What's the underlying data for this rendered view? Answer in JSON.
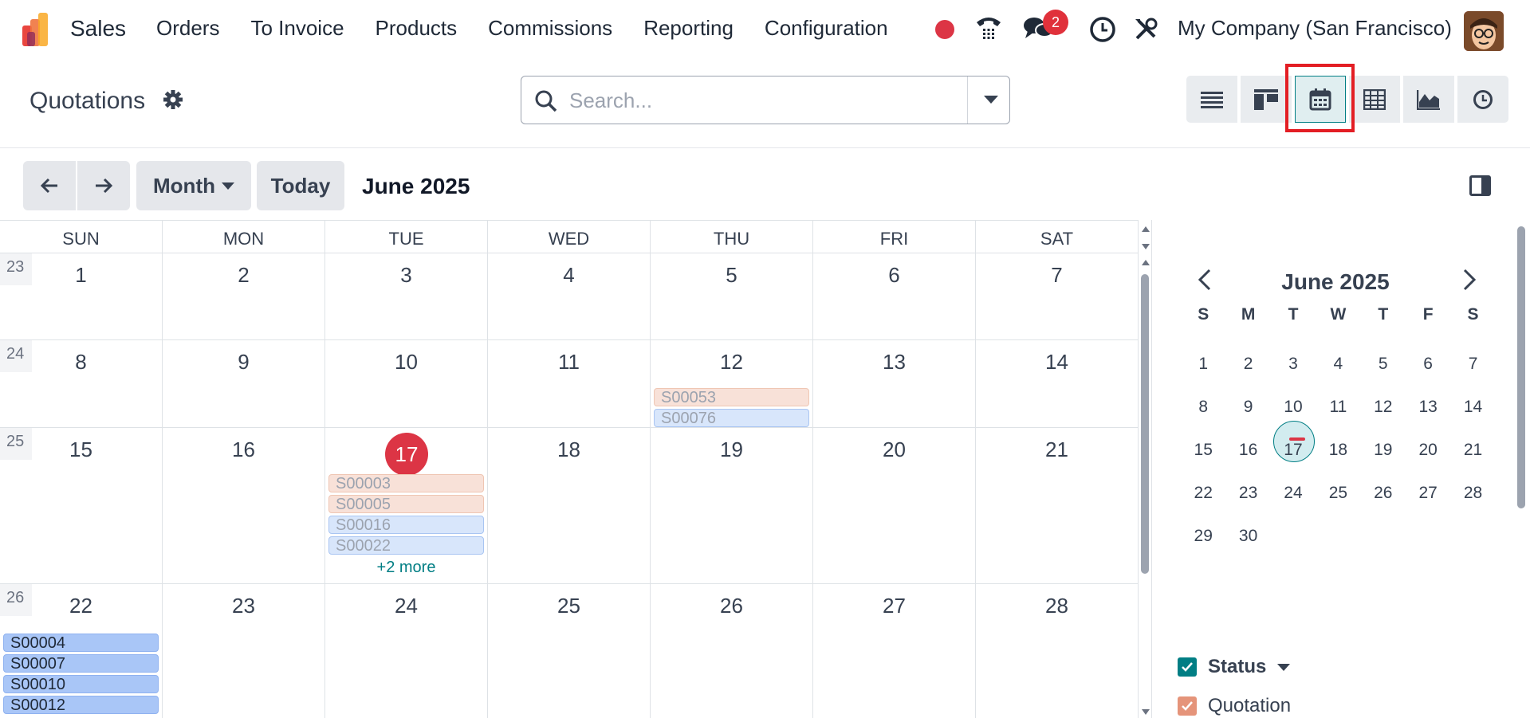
{
  "app": {
    "name": "Sales"
  },
  "menu": [
    "Orders",
    "To Invoice",
    "Products",
    "Commissions",
    "Reporting",
    "Configuration"
  ],
  "systray": {
    "chat_badge": "2",
    "company": "My Company (San Francisco)"
  },
  "control": {
    "title": "Quotations",
    "search_placeholder": "Search...",
    "views": [
      "list-view-icon",
      "kanban-view-icon",
      "calendar-view-icon",
      "pivot-view-icon",
      "graph-view-icon",
      "activity-view-icon"
    ],
    "active_view": "calendar-view-icon"
  },
  "calendar": {
    "scale_label": "Month",
    "today_label": "Today",
    "range_title": "June 2025",
    "dow": [
      "SUN",
      "MON",
      "TUE",
      "WED",
      "THU",
      "FRI",
      "SAT"
    ],
    "weeks": [
      {
        "weeknum": "23",
        "days": [
          "1",
          "2",
          "3",
          "4",
          "5",
          "6",
          "7"
        ]
      },
      {
        "weeknum": "24",
        "days": [
          "8",
          "9",
          "10",
          "11",
          "12",
          "13",
          "14"
        ]
      },
      {
        "weeknum": "25",
        "days": [
          "15",
          "16",
          "17",
          "18",
          "19",
          "20",
          "21"
        ]
      },
      {
        "weeknum": "26",
        "days": [
          "22",
          "23",
          "24",
          "25",
          "26",
          "27",
          "28"
        ]
      }
    ],
    "events": {
      "jun12": [
        "S00053",
        "S00076"
      ],
      "jun17": [
        "S00003",
        "S00005",
        "S00016",
        "S00022"
      ],
      "jun17_more": "+2 more",
      "jun22": [
        "S00004",
        "S00007",
        "S00010",
        "S00012"
      ]
    }
  },
  "sidebar": {
    "mini_title": "June 2025",
    "mini_dow": [
      "S",
      "M",
      "T",
      "W",
      "T",
      "F",
      "S"
    ],
    "mini_weeks": [
      [
        "1",
        "2",
        "3",
        "4",
        "5",
        "6",
        "7"
      ],
      [
        "8",
        "9",
        "10",
        "11",
        "12",
        "13",
        "14"
      ],
      [
        "15",
        "16",
        "17",
        "18",
        "19",
        "20",
        "21"
      ],
      [
        "22",
        "23",
        "24",
        "25",
        "26",
        "27",
        "28"
      ],
      [
        "29",
        "30",
        "",
        "",
        "",
        "",
        ""
      ]
    ],
    "selected_day": "17",
    "filter_group": "Status",
    "filter_items": [
      "Quotation"
    ]
  },
  "colors": {
    "accent": "#017e84",
    "today": "#dc3545",
    "event_orange": "#f8e1d8",
    "event_blue": "#d8e6fb",
    "event_blue_dark": "#a9c6f7",
    "highlight_box": "#e31e24"
  }
}
